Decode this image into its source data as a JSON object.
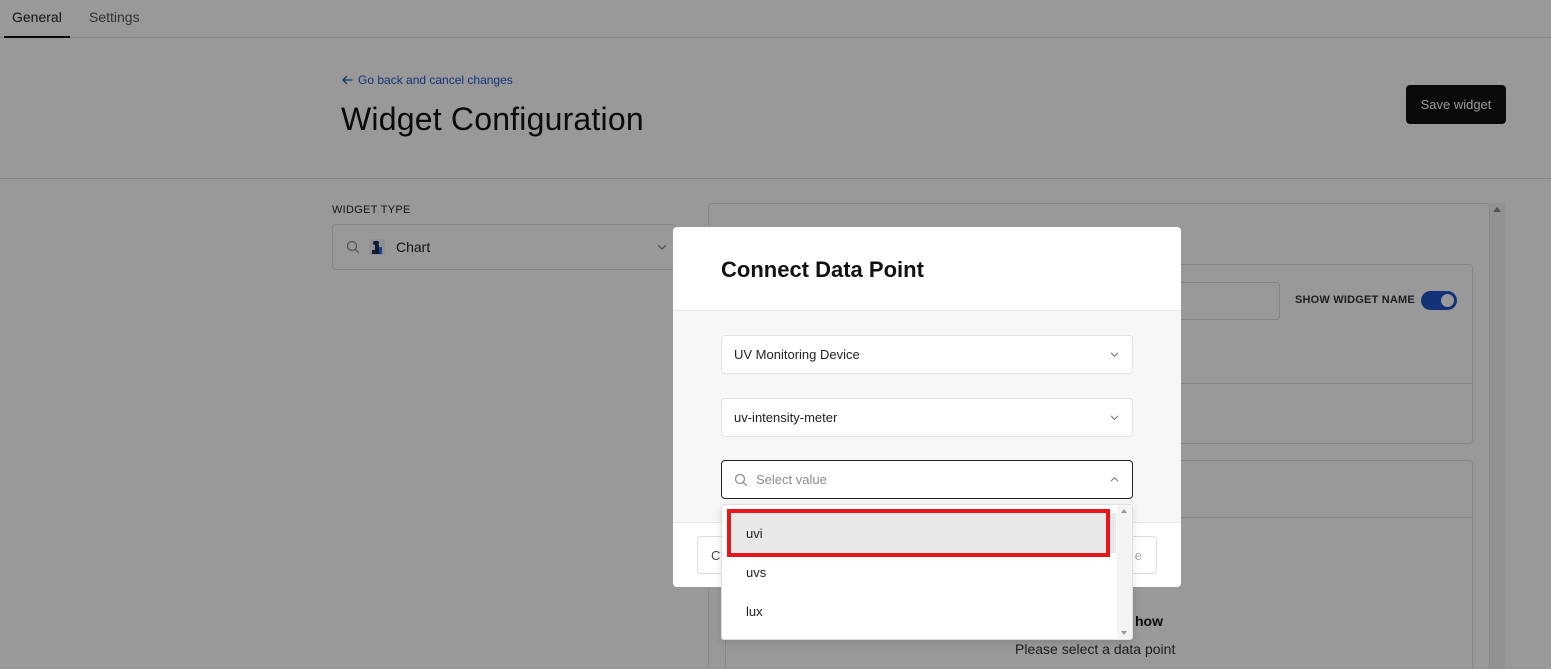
{
  "tabs": [
    {
      "label": "General",
      "active": true
    },
    {
      "label": "Settings",
      "active": false
    }
  ],
  "header": {
    "back_link": "Go back and cancel changes",
    "title": "Widget Configuration",
    "save_button": "Save widget"
  },
  "widget_type": {
    "label": "WIDGET TYPE",
    "value": "Chart"
  },
  "right_panel": {
    "show_widget_name_label": "SHOW WIDGET NAME",
    "show_widget_name_on": true,
    "empty_title_fragment": "how",
    "empty_message": "Please select a data point"
  },
  "modal": {
    "title": "Connect Data Point",
    "device": "UV Monitoring Device",
    "meter": "uv-intensity-meter",
    "value_placeholder": "Select value",
    "cancel_label_fragment": "C",
    "save_label_fragment": "e"
  },
  "dropdown": {
    "options": [
      "uvi",
      "uvs",
      "lux"
    ],
    "highlighted_index": 0
  },
  "colors": {
    "accent": "#1f56c9",
    "highlight_border": "#e8151b",
    "overlay": "rgba(0,0,0,0.40)"
  }
}
